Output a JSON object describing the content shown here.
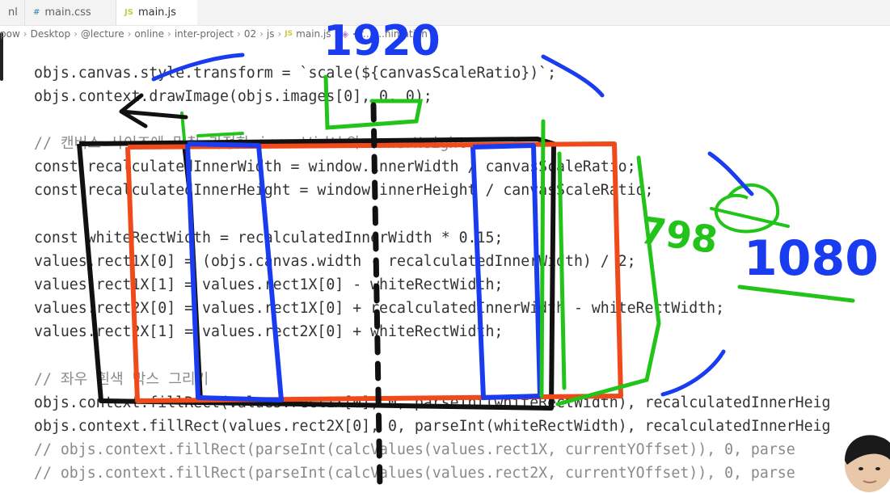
{
  "tabs": [
    {
      "label": "nl",
      "icon": ""
    },
    {
      "label": "main.css",
      "icon": "#"
    },
    {
      "label": "main.js",
      "icon": "JS"
    }
  ],
  "breadcrumb": [
    "pow",
    "Desktop",
    "@lecture",
    "online",
    "inter-project",
    "02",
    "js",
    "main.js",
    "<f...",
    "...nimation"
  ],
  "code": {
    "l1a": "objs.canvas.style.transform = `scale(${canvasScaleRatio})`;",
    "l2": "objs.context.drawImage(objs.images[0], 0, 0);",
    "l3": "// 캔버스 사이즈에 맞춰 가정한 innerWidth와 innerHeight",
    "l4": "const recalculatedInnerWidth = window.innerWidth / canvasScaleRatio;",
    "l5": "const recalculatedInnerHeight = window.innerHeight / canvasScaleRatio;",
    "l6": "const whiteRectWidth = recalculatedInnerWidth * 0.15;",
    "l7": "values.rect1X[0] = (objs.canvas.width - recalculatedInnerWidth) / 2;",
    "l8": "values.rect1X[1] = values.rect1X[0] - whiteRectWidth;",
    "l9": "values.rect2X[0] = values.rect1X[0] + recalculatedInnerWidth - whiteRectWidth;",
    "l10": "values.rect2X[1] = values.rect2X[0] + whiteRectWidth;",
    "l11": "// 좌우 흰색 박스 그리기",
    "l12": "objs.context.fillRect(values.rect1X[0], 0, parseInt(whiteRectWidth), recalculatedInnerHeig",
    "l13": "objs.context.fillRect(values.rect2X[0], 0, parseInt(whiteRectWidth), recalculatedInnerHeig",
    "l14": "// objs.context.fillRect(parseInt(calcValues(values.rect1X, currentYOffset)), 0, parse",
    "l15": "// objs.context.fillRect(parseInt(calcValues(values.rect2X, currentYOffset)), 0, parse"
  },
  "annotations": {
    "top": "1920",
    "right": "1080",
    "side": "798"
  },
  "colors": {
    "black": "#111111",
    "red": "#f04a1a",
    "blue": "#1a3cf0",
    "green": "#22c41a"
  }
}
